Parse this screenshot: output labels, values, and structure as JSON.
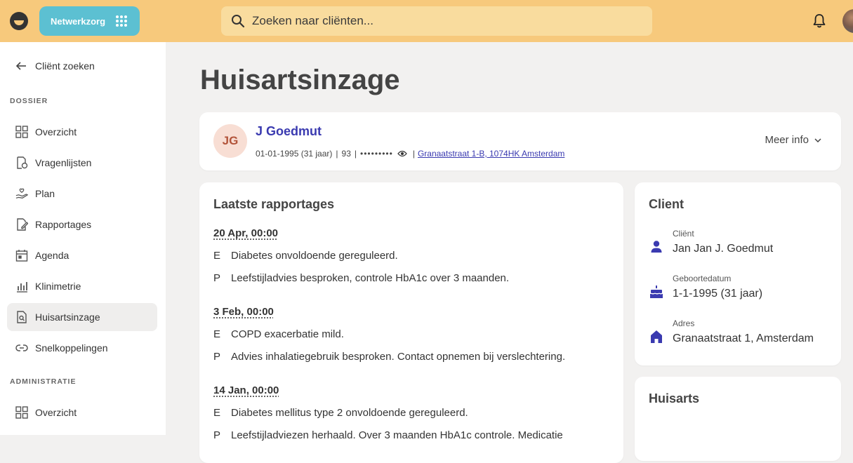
{
  "topbar": {
    "app_name": "Netwerkzorg",
    "search_placeholder": "Zoeken naar cliënten..."
  },
  "sidebar": {
    "back_label": "Cliënt zoeken",
    "sections": [
      {
        "label": "DOSSIER",
        "items": [
          {
            "label": "Overzicht",
            "icon": "grid-icon"
          },
          {
            "label": "Vragenlijsten",
            "icon": "questionnaire-icon"
          },
          {
            "label": "Plan",
            "icon": "plan-hand-icon"
          },
          {
            "label": "Rapportages",
            "icon": "report-edit-icon"
          },
          {
            "label": "Agenda",
            "icon": "calendar-icon"
          },
          {
            "label": "Klinimetrie",
            "icon": "bar-chart-icon"
          },
          {
            "label": "Huisartsinzage",
            "icon": "document-search-icon",
            "active": true
          },
          {
            "label": "Snelkoppelingen",
            "icon": "link-icon"
          }
        ]
      },
      {
        "label": "ADMINISTRATIE",
        "items": [
          {
            "label": "Overzicht",
            "icon": "grid-icon"
          }
        ]
      }
    ]
  },
  "page": {
    "title": "Huisartsinzage"
  },
  "patient": {
    "initials": "JG",
    "name": "J Goedmut",
    "dob_age": "01-01-1995 (31 jaar)",
    "number": "93",
    "masked_id": "•••••••••",
    "address": "Granaatstraat 1-B, 1074HK Amsterdam",
    "more_info": "Meer info"
  },
  "reports": {
    "title": "Laatste rapportages",
    "entries": [
      {
        "date": "20 Apr, 00:00",
        "lines": [
          {
            "key": "E",
            "text": "Diabetes onvoldoende gereguleerd."
          },
          {
            "key": "P",
            "text": "Leefstijladvies besproken, controle HbA1c over 3 maanden."
          }
        ]
      },
      {
        "date": "3 Feb, 00:00",
        "lines": [
          {
            "key": "E",
            "text": "COPD exacerbatie mild."
          },
          {
            "key": "P",
            "text": "Advies inhalatiegebruik besproken. Contact opnemen bij verslechtering."
          }
        ]
      },
      {
        "date": "14 Jan, 00:00",
        "lines": [
          {
            "key": "E",
            "text": "Diabetes mellitus type 2 onvoldoende gereguleerd."
          },
          {
            "key": "P",
            "text": "Leefstijladviezen herhaald. Over 3 maanden HbA1c controle. Medicatie"
          }
        ]
      }
    ]
  },
  "client": {
    "title": "Client",
    "rows": [
      {
        "label": "Cliënt",
        "value": "Jan Jan J. Goedmut",
        "icon": "person-icon"
      },
      {
        "label": "Geboortedatum",
        "value": "1-1-1995 (31 jaar)",
        "icon": "cake-icon"
      },
      {
        "label": "Adres",
        "value": "Granaatstraat 1, Amsterdam",
        "icon": "home-icon"
      }
    ]
  },
  "huisarts": {
    "title": "Huisarts"
  },
  "colors": {
    "topbar": "#f7c97c",
    "accent": "#3a3ab0",
    "switcher": "#5cc0d2"
  }
}
